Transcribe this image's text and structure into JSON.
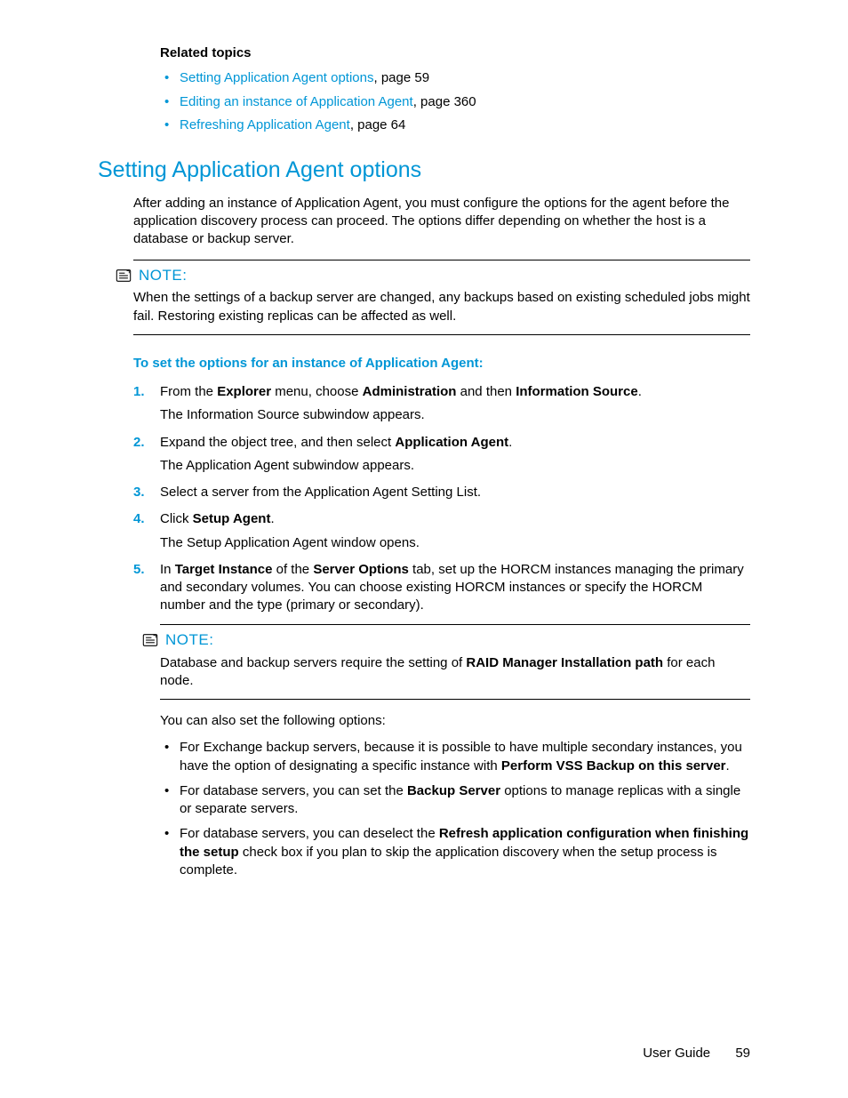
{
  "related": {
    "heading": "Related topics",
    "items": [
      {
        "link": "Setting Application Agent options",
        "suffix": ", page 59"
      },
      {
        "link": "Editing an instance of Application Agent",
        "suffix": ", page 360"
      },
      {
        "link": "Refreshing Application Agent",
        "suffix": ", page 64"
      }
    ]
  },
  "section_title": "Setting Application Agent options",
  "intro": "After adding an instance of Application Agent, you must configure the options for the agent before the application discovery process can proceed. The options differ depending on whether the host is a database or backup server.",
  "note1": {
    "label": "NOTE:",
    "body": "When the settings of a backup server are changed, any backups based on existing scheduled jobs might fail. Restoring existing replicas can be affected as well."
  },
  "sub_heading": "To set the options for an instance of Application Agent:",
  "steps": {
    "s1": {
      "pre": "From the ",
      "b1": "Explorer",
      "mid1": " menu, choose ",
      "b2": "Administration",
      "mid2": " and then ",
      "b3": "Information Source",
      "post": ".",
      "sub": "The Information Source subwindow appears."
    },
    "s2": {
      "pre": "Expand the object tree, and then select ",
      "b1": "Application Agent",
      "post": ".",
      "sub": "The Application Agent subwindow appears."
    },
    "s3": {
      "text": "Select a server from the Application Agent Setting List."
    },
    "s4": {
      "pre": "Click ",
      "b1": "Setup Agent",
      "post": ".",
      "sub": "The Setup Application Agent window opens."
    },
    "s5": {
      "pre": "In ",
      "b1": "Target Instance",
      "mid1": " of the ",
      "b2": "Server Options",
      "post": " tab, set up the HORCM instances managing the primary and secondary volumes. You can choose existing HORCM instances or specify the HORCM number and the type (primary or secondary)."
    }
  },
  "note2": {
    "label": "NOTE:",
    "pre": "Database and backup servers require the setting of ",
    "b1": "RAID Manager Installation path",
    "post": " for each node."
  },
  "cont_text": "You can also set the following options:",
  "opts": {
    "o1": {
      "pre": "For Exchange backup servers, because it is possible to have multiple secondary instances, you have the option of designating a specific instance with ",
      "b1": "Perform VSS Backup on this server",
      "post": "."
    },
    "o2": {
      "pre": "For database servers, you can set the ",
      "b1": "Backup Server",
      "post": " options to manage replicas with a single or separate servers."
    },
    "o3": {
      "pre": "For database servers, you can deselect the ",
      "b1": "Refresh application configuration when finishing the setup",
      "post": " check box if you plan to skip the application discovery when the setup process is complete."
    }
  },
  "footer": {
    "label": "User Guide",
    "page": "59"
  }
}
